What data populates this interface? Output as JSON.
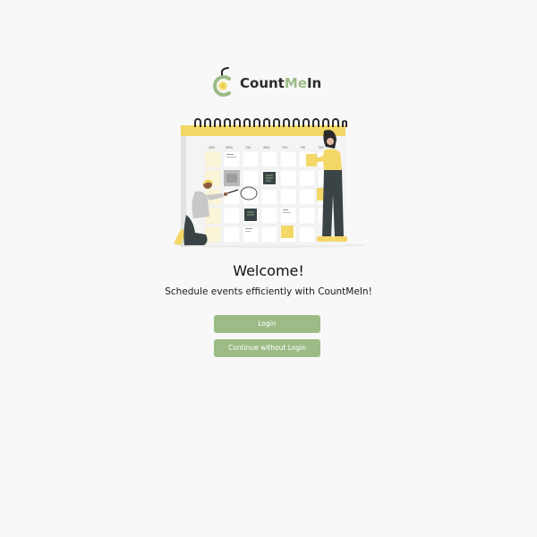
{
  "app": {
    "logo_part1": "Count",
    "logo_part2": "Me",
    "logo_part3": "In",
    "accent_color": "#9dbb86"
  },
  "illustration": {
    "icon": "calendar-scheduling-illustration",
    "day_headers": [
      "SUN",
      "MON",
      "TUE",
      "WED",
      "THU",
      "FRI",
      "SAT"
    ]
  },
  "main": {
    "title": "Welcome!",
    "subtitle": "Schedule events efficiently with CountMeIn!"
  },
  "buttons": {
    "login_label": "Login",
    "guest_label": "Continue without Login"
  }
}
